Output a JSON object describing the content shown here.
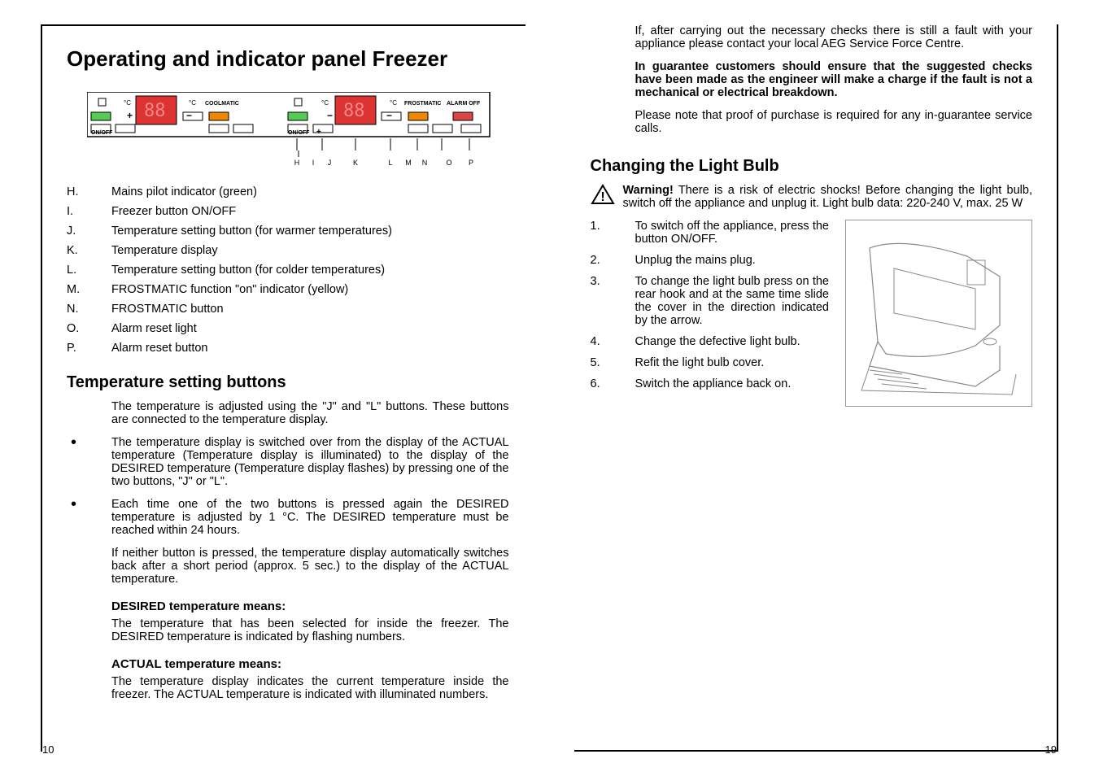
{
  "left": {
    "title": "Operating and indicator panel Freezer",
    "panel": {
      "labels": {
        "onoff1": "ON/OFF",
        "onoff2": "ON/OFF",
        "coolmatic": "COOLMATIC",
        "frostmatic": "FROSTMATIC",
        "alarmoff": "ALARM OFF",
        "deg1": "°C",
        "deg2": "°C",
        "deg3": "°C",
        "deg4": "°C",
        "plus1": "+",
        "plus2": "+",
        "minus1": "−",
        "minus2": "−",
        "letters": [
          "H",
          "I",
          "J",
          "K",
          "L",
          "M",
          "N",
          "O",
          "P"
        ]
      }
    },
    "legend": [
      {
        "letter": "H.",
        "text": "Mains pilot indicator (green)"
      },
      {
        "letter": "I.",
        "text": "Freezer button ON/OFF"
      },
      {
        "letter": "J.",
        "text": "Temperature setting button (for warmer temperatures)"
      },
      {
        "letter": "K.",
        "text": "Temperature display"
      },
      {
        "letter": "L.",
        "text": "Temperature setting button (for colder temperatures)"
      },
      {
        "letter": "M.",
        "text": "FROSTMATIC function \"on\" indicator (yellow)"
      },
      {
        "letter": "N.",
        "text": "FROSTMATIC button"
      },
      {
        "letter": "O.",
        "text": "Alarm reset light"
      },
      {
        "letter": "P.",
        "text": "Alarm reset button"
      }
    ],
    "tempSection": {
      "heading": "Temperature setting buttons",
      "intro": "The temperature is adjusted using the \"J\" and \"L\" buttons. These buttons are connected to the temperature display.",
      "bullets": [
        "The temperature display is switched over from the display of the ACTUAL temperature (Temperature display is illuminated) to the display of the DESIRED temperature (Temperature display flashes) by pressing one of the two buttons, \"J\" or \"L\".",
        "Each time one of the two buttons is pressed again the DESIRED temperature is adjusted by 1 °C. The DESIRED temperature must be reached within 24 hours."
      ],
      "afterBullets": "If neither button is pressed, the temperature display automatically switches back after a short period (approx. 5 sec.) to the display of the ACTUAL temperature.",
      "desiredHeading": "DESIRED temperature means:",
      "desiredText": "The temperature that has been selected for inside the freezer. The DESIRED temperature is indicated by flashing numbers.",
      "actualHeading": "ACTUAL temperature means:",
      "actualText": "The temperature display indicates the current temperature inside the freezer. The ACTUAL temperature is indicated with illuminated numbers."
    }
  },
  "right": {
    "topParas": [
      {
        "bold": false,
        "text": "If, after carrying out the necessary checks there is still a fault with your appliance please contact your local AEG Service Force Centre."
      },
      {
        "bold": true,
        "text": "In guarantee customers should ensure that the suggested checks have been made as the engineer will make a charge if the fault is not a mechanical or electrical breakdown."
      },
      {
        "bold": false,
        "text": "Please note that proof of purchase is required for any in-guarantee service calls."
      }
    ],
    "bulb": {
      "heading": "Changing the Light Bulb",
      "warningLabel": "Warning!",
      "warningText": " There is a risk of electric shocks! Before changing the light bulb, switch off the appliance and unplug it. Light bulb data: 220-240 V, max. 25 W",
      "steps": [
        {
          "n": "1.",
          "t": "To switch off the appliance, press the button ON/OFF."
        },
        {
          "n": "2.",
          "t": "Unplug the mains plug."
        },
        {
          "n": "3.",
          "t": "To change the light bulb press on the rear hook and at the same time slide the cover in the direction indicated by the arrow."
        },
        {
          "n": "4.",
          "t": "Change the defective light bulb."
        },
        {
          "n": "5.",
          "t": "Refit the light bulb cover."
        },
        {
          "n": "6.",
          "t": "Switch the appliance back on."
        }
      ]
    }
  },
  "pageNumbers": {
    "left": "10",
    "right": "19"
  }
}
